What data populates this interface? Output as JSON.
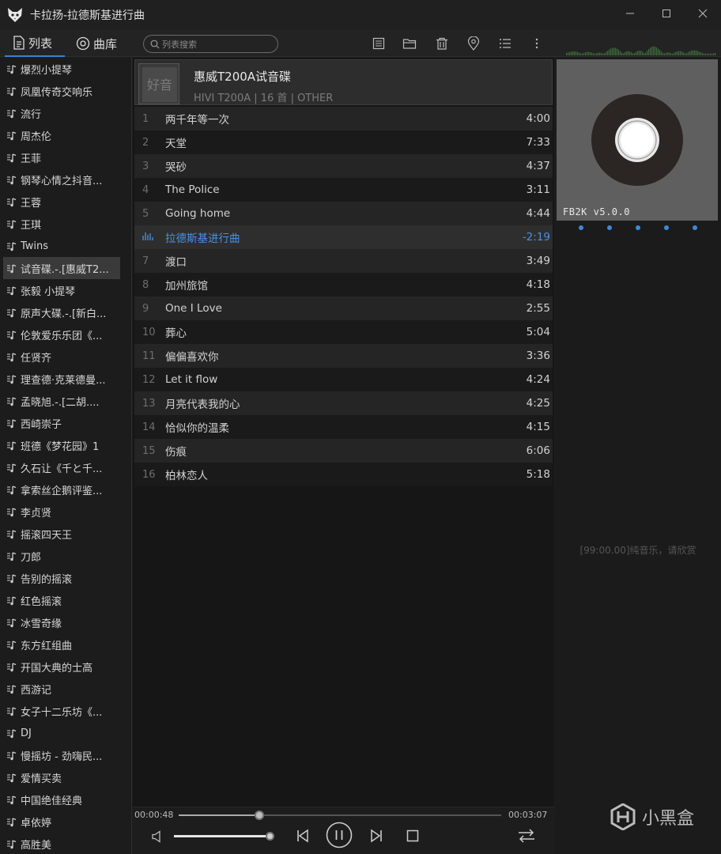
{
  "window": {
    "title": "卡拉扬-拉德斯基进行曲",
    "minimize_icon": "minimize-icon",
    "maximize_icon": "maximize-icon",
    "close_icon": "close-icon"
  },
  "tabs": [
    {
      "label": "列表",
      "icon": "document-icon"
    },
    {
      "label": "曲库",
      "icon": "disc-icon"
    }
  ],
  "search": {
    "placeholder": "列表搜索"
  },
  "toolbar_icons": [
    "list-view-icon",
    "folder-icon",
    "trash-icon",
    "locate-icon",
    "menu-list-icon",
    "more-vertical-icon"
  ],
  "sidebar": {
    "items": [
      "爆烈小提琴",
      "凤凰传奇交响乐",
      "流行",
      "周杰伦",
      "王菲",
      "钢琴心情之抖音...",
      "王蓉",
      "王琪",
      "Twins",
      "试音碟.-.[惠威T2...",
      "张毅 小提琴",
      "原声大碟.-.[新白...",
      "伦敦爱乐乐团《...",
      "任贤齐",
      "理查德·克莱德曼...",
      "孟晓旭.-.[二胡....",
      "西崎崇子",
      "班德《梦花园》1",
      "久石让《千と千...",
      "拿索丝企鹅评鉴...",
      "李贞贤",
      "摇滚四天王",
      "刀郎",
      "告别的摇滚",
      "红色摇滚",
      "冰雪奇缘",
      "东方红组曲",
      "开国大典的士高",
      "西游记",
      "女子十二乐坊《...",
      "DJ",
      "慢摇坊 - 劲嗨民...",
      "爱情买卖",
      "中国绝佳经典",
      "卓依婷",
      "高胜美"
    ],
    "active_index": 9
  },
  "album": {
    "name": "惠威T200A试音碟",
    "subtitle": "HIVI T200A | 16 首 | OTHER",
    "art_text": "好音"
  },
  "tracks": [
    {
      "num": "1",
      "title": "两千年等一次",
      "duration": "4:00"
    },
    {
      "num": "2",
      "title": "天堂",
      "duration": "7:33"
    },
    {
      "num": "3",
      "title": "哭砂",
      "duration": "4:37"
    },
    {
      "num": "4",
      "title": "The Police",
      "duration": "3:11"
    },
    {
      "num": "5",
      "title": "Going home",
      "duration": "4:44"
    },
    {
      "num": "",
      "title": "拉德斯基进行曲",
      "duration": "-2:19",
      "playing": true
    },
    {
      "num": "7",
      "title": "渡口",
      "duration": "3:49"
    },
    {
      "num": "8",
      "title": "加州旅馆",
      "duration": "4:18"
    },
    {
      "num": "9",
      "title": "One I Love",
      "duration": "2:55"
    },
    {
      "num": "10",
      "title": "葬心",
      "duration": "5:04"
    },
    {
      "num": "11",
      "title": "偏偏喜欢你",
      "duration": "3:36"
    },
    {
      "num": "12",
      "title": "Let it flow",
      "duration": "4:24"
    },
    {
      "num": "13",
      "title": "月亮代表我的心",
      "duration": "4:25"
    },
    {
      "num": "14",
      "title": "恰似你的温柔",
      "duration": "4:15"
    },
    {
      "num": "15",
      "title": "伤痕",
      "duration": "6:06"
    },
    {
      "num": "16",
      "title": "柏林恋人",
      "duration": "5:18"
    }
  ],
  "player": {
    "elapsed": "00:00:48",
    "total": "00:03:07",
    "progress": 0.25,
    "volume": 0.98
  },
  "right_panel": {
    "version": "FB2K v5.0.0",
    "lyric": "[99:00.00]纯音乐，请欣赏",
    "dots": 5
  },
  "watermark": {
    "text": "小黑盒"
  },
  "colors": {
    "accent": "#4a90e2",
    "background": "#1e1e1e"
  }
}
